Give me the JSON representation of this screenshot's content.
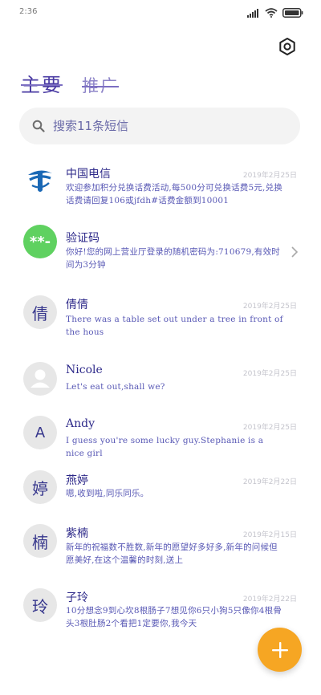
{
  "status_bar": {
    "time": "2:36"
  },
  "header": {
    "tabs": [
      {
        "label": "主要"
      },
      {
        "label": "推广"
      }
    ]
  },
  "search": {
    "placeholder": "搜索11条短信"
  },
  "messages": [
    {
      "sender": "中国电信",
      "date": "2019年2月25日",
      "preview": "欢迎参加积分兑换话费活动,每500分可兑换话费5元,兑换话费请回复106或jfdh#话费金额到10001",
      "avatar_text": ""
    },
    {
      "sender": "验证码",
      "date": "",
      "preview": "你好!您的网上营业厅登录的随机密码为:710679,有效时间为3分钟",
      "avatar_text": "**-"
    },
    {
      "sender": "倩倩",
      "date": "2019年2月25日",
      "preview": "There was a table set out under a tree in front of the hous",
      "avatar_text": "倩"
    },
    {
      "sender": "Nicole",
      "date": "2019年2月25日",
      "preview": "Let's eat out,shall we?",
      "avatar_text": ""
    },
    {
      "sender": "Andy",
      "date": "2019年2月25日",
      "preview": "I guess you're some lucky guy.Stephanie is a nice girl",
      "avatar_text": "A"
    },
    {
      "sender": "燕婷",
      "date": "2019年2月22日",
      "preview": "嗯,收到啦,同乐同乐。",
      "avatar_text": "婷"
    },
    {
      "sender": "紫楠",
      "date": "2019年2月15日",
      "preview": "新年的祝福数不胜数,新年的愿望好多好多,新年的问候但愿美好,在这个温馨的时刻,送上",
      "avatar_text": "楠"
    },
    {
      "sender": "子玲",
      "date": "2019年2月22日",
      "preview": "10分想念9到心坎8根肠子7想见你6只小狗5只像你4根骨头3根肚肠2个看把1定要你,我今天",
      "avatar_text": "玲"
    }
  ]
}
